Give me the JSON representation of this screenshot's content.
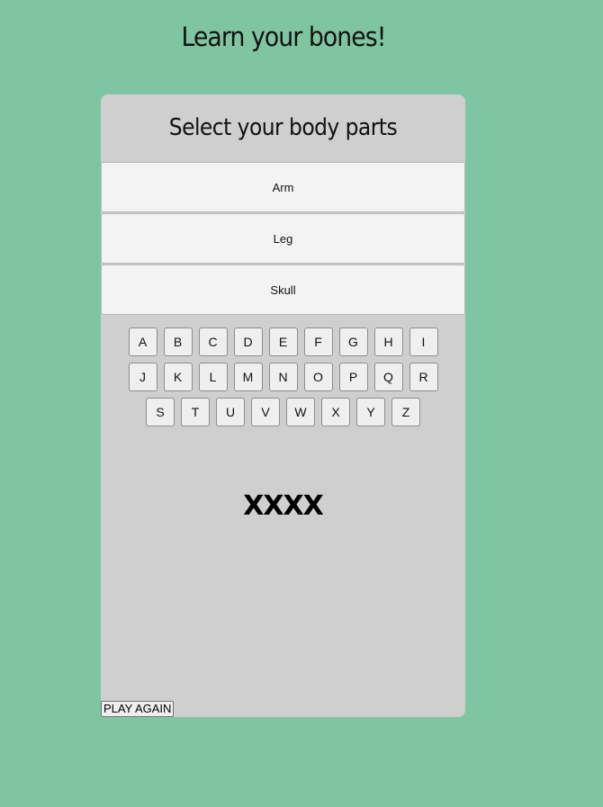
{
  "header": {
    "title": "Learn your bones!"
  },
  "panel": {
    "title": "Select your body parts",
    "body_parts": [
      "Arm",
      "Leg",
      "Skull"
    ],
    "letters": {
      "row1": [
        "A",
        "B",
        "C",
        "D",
        "E",
        "F",
        "G",
        "H",
        "I"
      ],
      "row2": [
        "J",
        "K",
        "L",
        "M",
        "N",
        "O",
        "P",
        "Q",
        "R"
      ],
      "row3": [
        "S",
        "T",
        "U",
        "V",
        "W",
        "X",
        "Y",
        "Z"
      ]
    },
    "word": "XXXX",
    "play_again_label": "PLAY AGAIN"
  },
  "colors": {
    "background": "#80c5a2",
    "panel": "#cfcfcf",
    "button": "#f3f3f3"
  }
}
